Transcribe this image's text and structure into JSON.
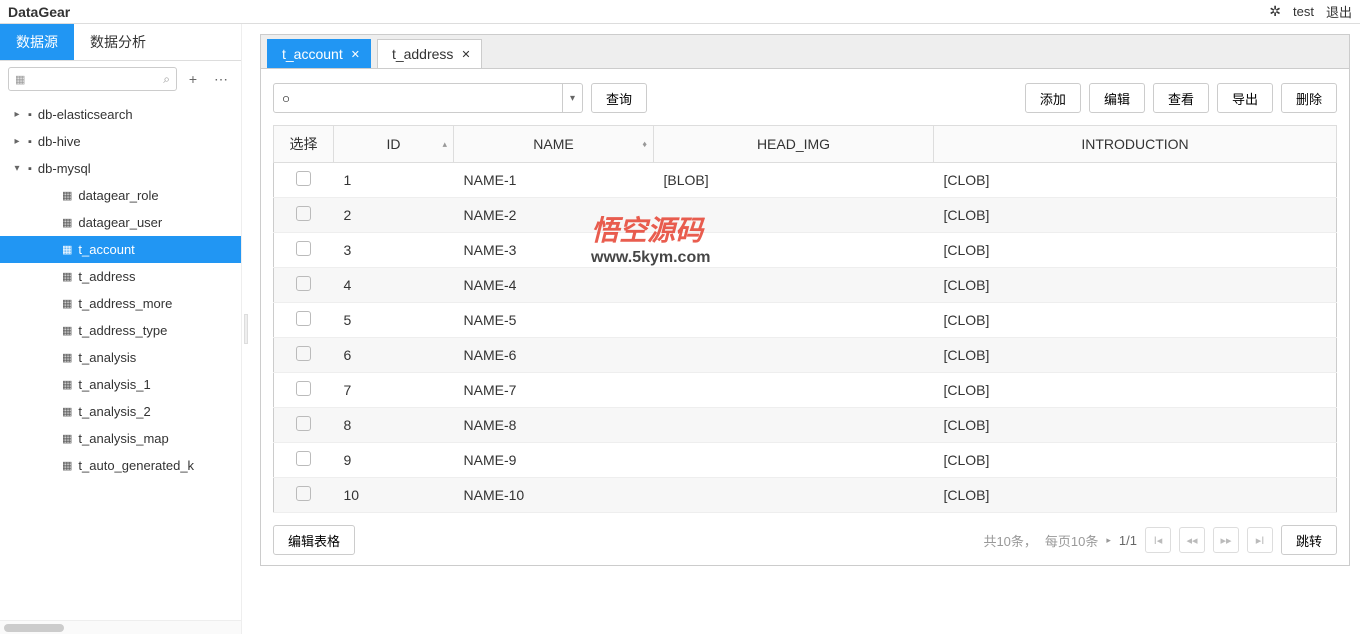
{
  "app_title": "DataGear",
  "header": {
    "user": "test",
    "logout": "退出"
  },
  "sidebar": {
    "tabs": [
      "数据源",
      "数据分析"
    ],
    "tree": [
      {
        "label": "db-elasticsearch",
        "level": 0,
        "expanded": false,
        "toggle": "▸",
        "icon": "folder"
      },
      {
        "label": "db-hive",
        "level": 0,
        "expanded": false,
        "toggle": "▸",
        "icon": "folder"
      },
      {
        "label": "db-mysql",
        "level": 0,
        "expanded": true,
        "toggle": "▾",
        "icon": "folder"
      },
      {
        "label": "datagear_role",
        "level": 1,
        "icon": "table"
      },
      {
        "label": "datagear_user",
        "level": 1,
        "icon": "table"
      },
      {
        "label": "t_account",
        "level": 1,
        "icon": "table",
        "selected": true
      },
      {
        "label": "t_address",
        "level": 1,
        "icon": "table"
      },
      {
        "label": "t_address_more",
        "level": 1,
        "icon": "table"
      },
      {
        "label": "t_address_type",
        "level": 1,
        "icon": "table"
      },
      {
        "label": "t_analysis",
        "level": 1,
        "icon": "table"
      },
      {
        "label": "t_analysis_1",
        "level": 1,
        "icon": "table"
      },
      {
        "label": "t_analysis_2",
        "level": 1,
        "icon": "table"
      },
      {
        "label": "t_analysis_map",
        "level": 1,
        "icon": "table"
      },
      {
        "label": "t_auto_generated_k",
        "level": 1,
        "icon": "table"
      }
    ]
  },
  "content_tabs": [
    {
      "label": "t_account",
      "active": true
    },
    {
      "label": "t_address",
      "active": false
    }
  ],
  "actions": {
    "query": "查询",
    "right": [
      "添加",
      "编辑",
      "查看",
      "导出",
      "删除"
    ]
  },
  "table": {
    "headers": {
      "select": "选择",
      "id": "ID",
      "name": "NAME",
      "head_img": "HEAD_IMG",
      "intro": "INTRODUCTION"
    },
    "rows": [
      {
        "id": "1",
        "name": "NAME-1",
        "head_img": "[BLOB]",
        "intro": "[CLOB]"
      },
      {
        "id": "2",
        "name": "NAME-2",
        "head_img": "",
        "intro": "[CLOB]"
      },
      {
        "id": "3",
        "name": "NAME-3",
        "head_img": "",
        "intro": "[CLOB]"
      },
      {
        "id": "4",
        "name": "NAME-4",
        "head_img": "",
        "intro": "[CLOB]"
      },
      {
        "id": "5",
        "name": "NAME-5",
        "head_img": "",
        "intro": "[CLOB]"
      },
      {
        "id": "6",
        "name": "NAME-6",
        "head_img": "",
        "intro": "[CLOB]"
      },
      {
        "id": "7",
        "name": "NAME-7",
        "head_img": "",
        "intro": "[CLOB]"
      },
      {
        "id": "8",
        "name": "NAME-8",
        "head_img": "",
        "intro": "[CLOB]"
      },
      {
        "id": "9",
        "name": "NAME-9",
        "head_img": "",
        "intro": "[CLOB]"
      },
      {
        "id": "10",
        "name": "NAME-10",
        "head_img": "",
        "intro": "[CLOB]"
      }
    ]
  },
  "footer": {
    "edit_grid": "编辑表格",
    "total": "共10条，",
    "per_page": "每页10条",
    "page": "1/1",
    "jump": "跳转"
  },
  "watermark": {
    "title": "悟空源码",
    "url": "www.5kym.com"
  }
}
